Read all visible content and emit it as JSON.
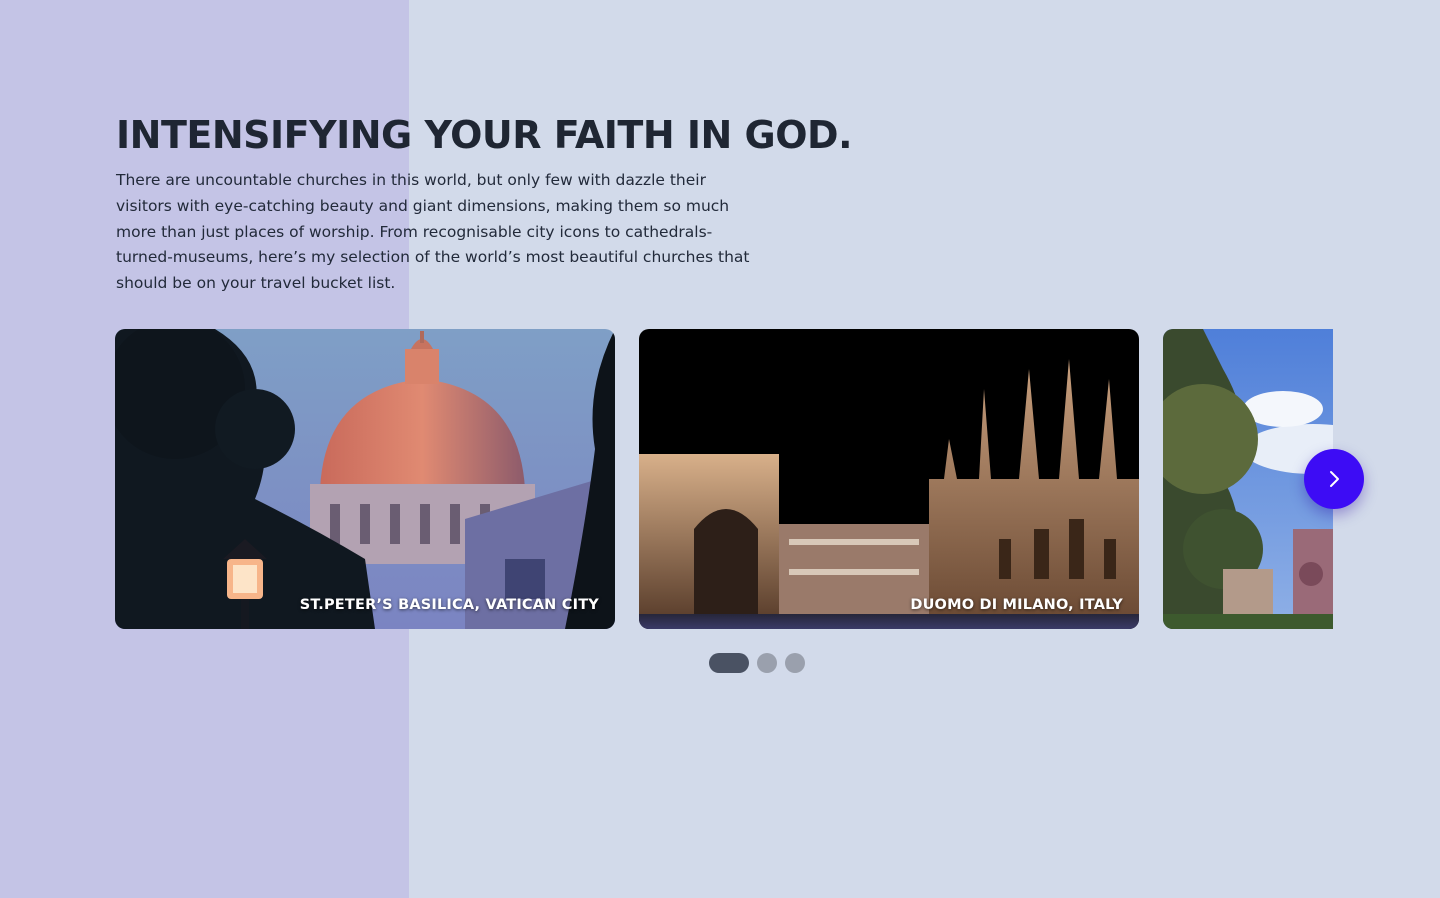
{
  "hero": {
    "title": "INTENSIFYING YOUR FAITH IN GOD.",
    "description": "There are uncountable churches in this world, but only few with dazzle their visitors with eye-catching beauty and giant dimensions, making them so much more than just places of worship. From recognisable city icons to cathedrals-turned-museums, here’s my selection of the world’s most beautiful churches that should be on your travel bucket list."
  },
  "carousel": {
    "cards": [
      {
        "label": "ST.PETER’S BASILICA, VATICAN CITY"
      },
      {
        "label": "DUOMO DI MILANO, ITALY"
      },
      {
        "label": ""
      }
    ],
    "next_icon": "chevron-right-icon",
    "pagination": {
      "total": 3,
      "active": 1
    }
  },
  "colors": {
    "background": "#d2daea",
    "left_panel": "#c4c4e6",
    "accent": "#3d0cf5",
    "dot_active": "#4a5263",
    "dot_inactive": "#9aa0ad"
  }
}
